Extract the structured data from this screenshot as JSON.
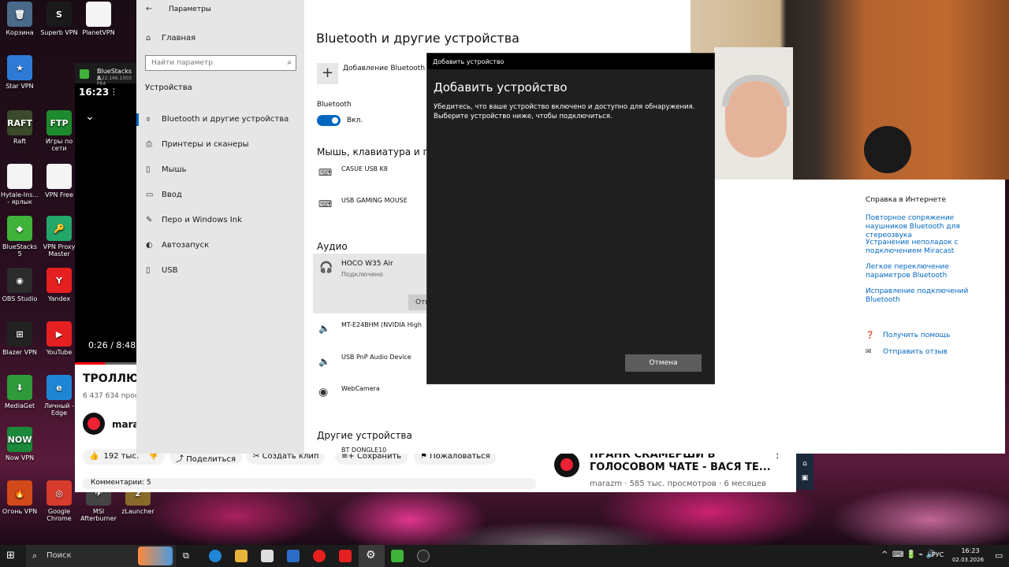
{
  "desktop": {
    "icons": [
      {
        "label": "Корзина",
        "glyph": "🗑",
        "color": "#4a6a8a"
      },
      {
        "label": "Superb VPN",
        "glyph": "S",
        "color": "#1a1a1a"
      },
      {
        "label": "PlanetVPN",
        "glyph": "",
        "color": "#f4f4f4"
      },
      {
        "label": "Star VPN",
        "glyph": "★",
        "color": "#2d7bd6"
      },
      {
        "label": "Raft",
        "glyph": "RAFT",
        "color": "#3a4a2a"
      },
      {
        "label": "Игры по сети",
        "glyph": "FTP",
        "color": "#1e8a2e"
      },
      {
        "label": "Hytale-Ins... - ярлык",
        "glyph": "",
        "color": "#f4f4f4"
      },
      {
        "label": "VPN Free",
        "glyph": "",
        "color": "#f4f4f4"
      },
      {
        "label": "BlueStacks 5",
        "glyph": "◆",
        "color": "#3fb23a"
      },
      {
        "label": "VPN Proxy Master",
        "glyph": "🔑",
        "color": "#23a86a"
      },
      {
        "label": "OBS Studio",
        "glyph": "◉",
        "color": "#2b2b2b"
      },
      {
        "label": "Yandex",
        "glyph": "Y",
        "color": "#e62020"
      },
      {
        "label": "Blazer VPN",
        "glyph": "⊞",
        "color": "#222222"
      },
      {
        "label": "YouTube",
        "glyph": "▶",
        "color": "#e62020"
      },
      {
        "label": "MediaGet",
        "glyph": "⬇",
        "color": "#2f9a3a"
      },
      {
        "label": "Личный - Edge",
        "glyph": "e",
        "color": "#1f86d6"
      },
      {
        "label": "Now VPN",
        "glyph": "NOW",
        "color": "#1a8a3a"
      },
      {
        "label": "Огонь VPN",
        "glyph": "🔥",
        "color": "#d24a1a"
      },
      {
        "label": "Google Chrome",
        "glyph": "◎",
        "color": "#d63b2b"
      },
      {
        "label": "MSI Afterburner",
        "glyph": "✈",
        "color": "#444444"
      },
      {
        "label": "zLauncher",
        "glyph": "z",
        "color": "#8a6a2a"
      }
    ]
  },
  "bluestacks": {
    "title": "BlueStacks A",
    "subtitle": "5.22.166.1003 P64"
  },
  "video_overlay": {
    "clock": "16:23",
    "progress": "0:26 / 8:48"
  },
  "youtube": {
    "title": "ТРОЛЛЮ",
    "views": "6 437 634 прос",
    "channel": "maraz",
    "likes": "192 тыс.",
    "share": "Поделиться",
    "clip": "Создать клип",
    "save": "Сохранить",
    "report": "Пожаловаться",
    "comments": "Комментарии: 5",
    "rec_title_1": "ПРАНК СКАМЕРШИ В",
    "rec_title_2": "ГОЛОСОВОМ ЧАТЕ - ВАСЯ ТЕ...",
    "rec_meta": "marazm · 585 тыс. просмотров · 6 месяцев"
  },
  "settings": {
    "window_title": "Параметры",
    "home": "Главная",
    "search_placeholder": "Найти параметр",
    "section": "Устройства",
    "nav": [
      {
        "label": "Bluetooth и другие устройства",
        "icon": "bluetooth-icon",
        "glyph": "⌽"
      },
      {
        "label": "Принтеры и сканеры",
        "icon": "printer-icon",
        "glyph": "⎙"
      },
      {
        "label": "Мышь",
        "icon": "mouse-icon",
        "glyph": "▯"
      },
      {
        "label": "Ввод",
        "icon": "keyboard-icon",
        "glyph": "▭"
      },
      {
        "label": "Перо и Windows Ink",
        "icon": "pen-icon",
        "glyph": "✎"
      },
      {
        "label": "Автозапуск",
        "icon": "autoplay-icon",
        "glyph": "◐"
      },
      {
        "label": "USB",
        "icon": "usb-icon",
        "glyph": "▯"
      }
    ],
    "page_title": "Bluetooth и другие устройства",
    "add_device": "Добавление Bluetooth и",
    "bluetooth_label": "Bluetooth",
    "bluetooth_state": "Вкл.",
    "mouse_section": "Мышь, клавиатура и п",
    "kb_device": "CASUE USB K8",
    "mouse_device": "USB GAMING MOUSE",
    "audio_section": "Аудио",
    "audio_device": "HOCO W35 Air",
    "audio_status": "Подключено",
    "remove_btn": "Отм",
    "monitor_device": "MT-E24BHM (NVIDIA High",
    "usb_audio": "USB PnP Audio Device",
    "webcam": "WebCamera",
    "other_section": "Другие устройства",
    "other_device": "BT DONGLE10",
    "help_title": "Справка в Интернете",
    "help_links": [
      "Повторное сопряжение наушников Bluetooth для стереозвука",
      "Устранение неполадок с подключением Miracast",
      "Легкое переключение параметров Bluetooth",
      "Исправление подключений Bluetooth"
    ],
    "get_help": "Получить помощь",
    "feedback": "Отправить отзыв"
  },
  "dialog": {
    "window_title": "Добавить устройство",
    "heading": "Добавить устройство",
    "description": "Убедитесь, что ваше устройство включено и доступно для обнаружения. Выберите устройство ниже, чтобы подключиться.",
    "cancel": "Отмена"
  },
  "taskbar": {
    "search": "Поиск",
    "lang": "РУС",
    "time": "16:23",
    "date": "02.03.2026"
  }
}
